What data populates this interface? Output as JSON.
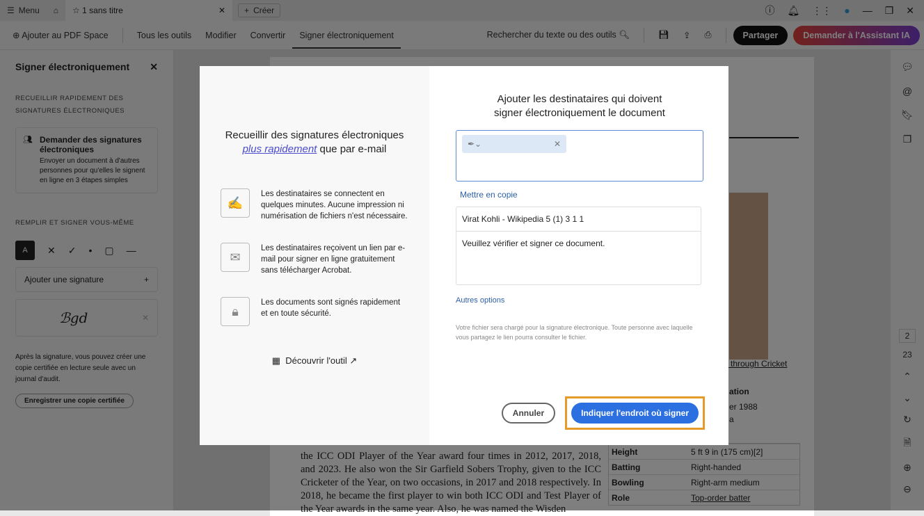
{
  "tabbar": {
    "menu": "Menu",
    "tab_title": "1 sans titre",
    "create": "Créer"
  },
  "toolbar": {
    "add_pdf_space": "Ajouter au PDF Space",
    "items": [
      "Tous les outils",
      "Modifier",
      "Convertir",
      "Signer électroniquement"
    ],
    "search": "Rechercher du texte ou des outils",
    "share": "Partager",
    "ai": "Demander à l'Assistant IA"
  },
  "panel": {
    "title": "Signer électroniquement",
    "section1": "RECUEILLIR RAPIDEMENT DES SIGNATURES ÉLECTRONIQUES",
    "card_title": "Demander des signatures électroniques",
    "card_desc": "Envoyer un document à d'autres personnes pour qu'elles le signent en ligne en 3 étapes simples",
    "section2": "REMPLIR ET SIGNER VOUS-MÊME",
    "add_signature": "Ajouter une signature",
    "signature_text": "Bgd",
    "note": "Après la signature, vous pouvez créer une copie certifiée en lecture seule avec un journal d'audit.",
    "certify": "Enregistrer une copie certifiée"
  },
  "document": {
    "paragraph": "the ICC ODI Player of the Year award four times in 2012, 2017, 2018, and 2023. He also won the Sir Garfield Sobers Trophy, given to the ICC Cricketer of the Year, on two occasions, in 2017 and 2018 respectively. In 2018, he became the first player to win both ICC ODI and Test Player of the Year awards in the same year. Also, he was named the Wisden",
    "caption": "o through Cricket",
    "info_header": "ation",
    "info_dob": "er 1988",
    "info_place": "a",
    "rows": [
      {
        "k": "Height",
        "v": "5 ft 9 in (175 cm)[2]"
      },
      {
        "k": "Batting",
        "v": "Right-handed"
      },
      {
        "k": "Bowling",
        "v": "Right-arm medium"
      },
      {
        "k": "Role",
        "v": "Top-order batter"
      }
    ]
  },
  "rail": {
    "page": "2",
    "total": "23"
  },
  "modal": {
    "left_title_1": "Recueillir des signatures électroniques",
    "left_title_link": "plus rapidement",
    "left_title_2": "que par e-mail",
    "features": [
      "Les destinataires se connectent en quelques minutes. Aucune impression ni numérisation de fichiers n'est nécessaire.",
      "Les destinataires reçoivent un lien par e-mail pour signer en ligne gratuitement sans télécharger Acrobat.",
      "Les documents sont signés rapidement et en toute sécurité."
    ],
    "discover": "Découvrir l'outil",
    "right_title": "Ajouter les destinataires qui doivent signer électroniquement le document",
    "cc": "Mettre en copie",
    "subject": "Virat Kohli - Wikipedia 5 (1) 3 1 1",
    "message": "Veuillez vérifier et signer ce document.",
    "more": "Autres options",
    "note": "Votre fichier sera chargé pour la signature électronique. Toute personne avec laquelle vous partagez le lien pourra consulter le fichier.",
    "cancel": "Annuler",
    "primary": "Indiquer l'endroit où signer"
  }
}
